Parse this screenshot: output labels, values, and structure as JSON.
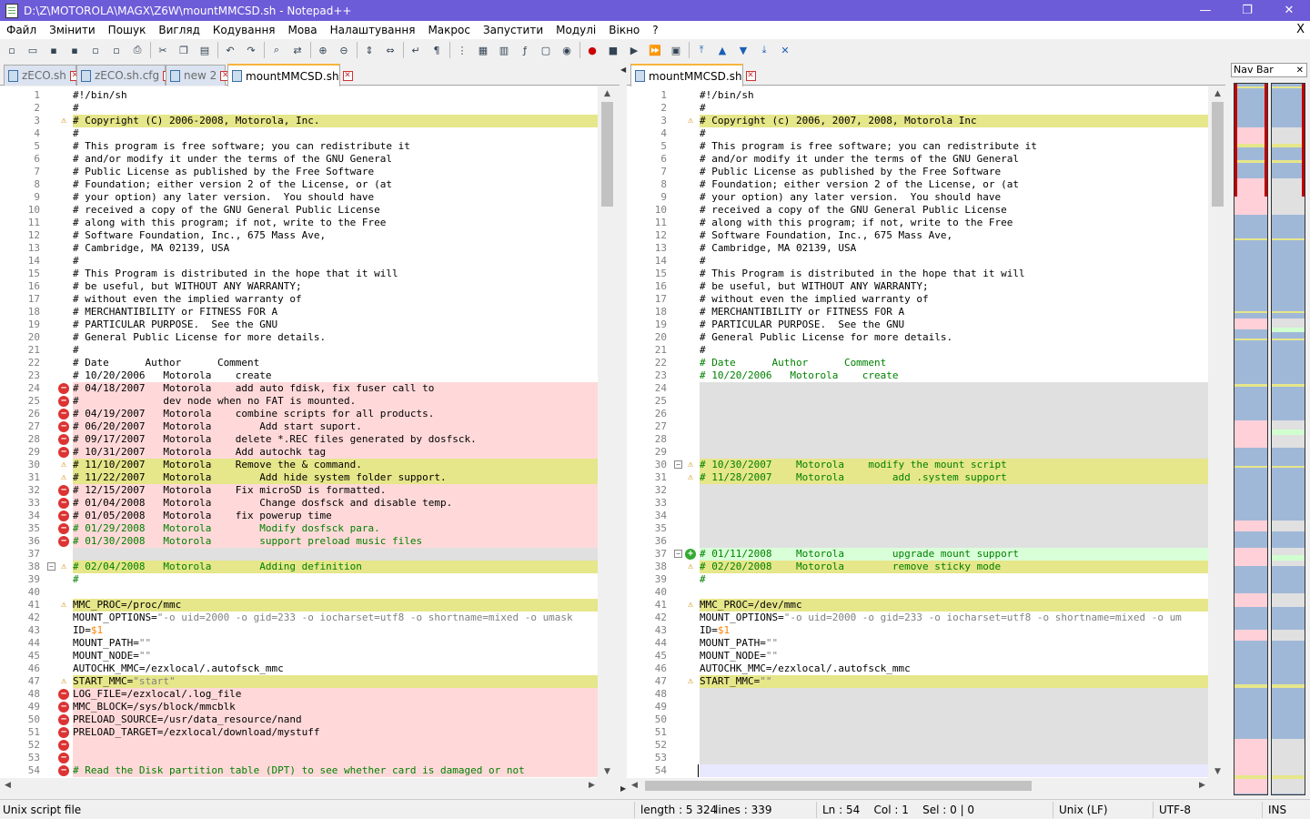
{
  "window": {
    "title": "D:\\Z\\MOTOROLA\\MAGX\\Z6W\\mountMMCSD.sh - Notepad++",
    "minimize": "—",
    "restore": "❐",
    "close": "✕"
  },
  "menu": {
    "items": [
      "Файл",
      "Змінити",
      "Пошук",
      "Вигляд",
      "Кодування",
      "Мова",
      "Налаштування",
      "Макрос",
      "Запустити",
      "Модулі",
      "Вікно",
      "?"
    ],
    "close": "X"
  },
  "toolbar": {
    "icons": [
      "new-icon",
      "open-icon",
      "save-icon",
      "save-all-icon",
      "close-icon",
      "close-all-icon",
      "print-icon",
      "|",
      "cut-icon",
      "copy-icon",
      "paste-icon",
      "|",
      "undo-icon",
      "redo-icon",
      "|",
      "find-icon",
      "replace-icon",
      "|",
      "zoom-in-icon",
      "zoom-out-icon",
      "|",
      "sync-v-icon",
      "sync-h-icon",
      "|",
      "wrap-icon",
      "all-chars-icon",
      "|",
      "indent-guide-icon",
      "udl-icon",
      "doc-map-icon",
      "func-list-icon",
      "folder-icon",
      "monitor-icon",
      "|",
      "record-icon",
      "stop-icon",
      "play-icon",
      "play-multi-icon",
      "save-macro-icon",
      "|",
      "compare-first-icon",
      "compare-prev-icon",
      "compare-next-icon",
      "compare-last-icon",
      "compare-clear-icon"
    ]
  },
  "left": {
    "tabs": [
      {
        "label": "zECO.sh",
        "active": false
      },
      {
        "label": "zECO.sh.cfg",
        "active": false
      },
      {
        "label": "new 2",
        "active": false
      },
      {
        "label": "mountMMCSD.sh",
        "active": true
      }
    ],
    "lines": [
      {
        "n": "1",
        "t": "#!/bin/sh",
        "bg": "",
        "m": "",
        "c": "cm"
      },
      {
        "n": "2",
        "t": "#",
        "bg": "",
        "m": "",
        "c": "cm"
      },
      {
        "n": "3",
        "t": "# Copyright (C) 2006-2008, Motorola, Inc.",
        "bg": "w",
        "m": "warn",
        "c": "cm"
      },
      {
        "n": "4",
        "t": "#",
        "bg": "",
        "m": "",
        "c": "cm"
      },
      {
        "n": "5",
        "t": "# This program is free software; you can redistribute it",
        "bg": "",
        "m": "",
        "c": "cm"
      },
      {
        "n": "6",
        "t": "# and/or modify it under the terms of the GNU General",
        "bg": "",
        "m": "",
        "c": "cm"
      },
      {
        "n": "7",
        "t": "# Public License as published by the Free Software",
        "bg": "",
        "m": "",
        "c": "cm"
      },
      {
        "n": "8",
        "t": "# Foundation; either version 2 of the License, or (at",
        "bg": "",
        "m": "",
        "c": "cm"
      },
      {
        "n": "9",
        "t": "# your option) any later version.  You should have",
        "bg": "",
        "m": "",
        "c": "cm"
      },
      {
        "n": "10",
        "t": "# received a copy of the GNU General Public License",
        "bg": "",
        "m": "",
        "c": "cm"
      },
      {
        "n": "11",
        "t": "# along with this program; if not, write to the Free",
        "bg": "",
        "m": "",
        "c": "cm"
      },
      {
        "n": "12",
        "t": "# Software Foundation, Inc., 675 Mass Ave,",
        "bg": "",
        "m": "",
        "c": "cm"
      },
      {
        "n": "13",
        "t": "# Cambridge, MA 02139, USA",
        "bg": "",
        "m": "",
        "c": "cm"
      },
      {
        "n": "14",
        "t": "#",
        "bg": "",
        "m": "",
        "c": "cm"
      },
      {
        "n": "15",
        "t": "# This Program is distributed in the hope that it will",
        "bg": "",
        "m": "",
        "c": "cm"
      },
      {
        "n": "16",
        "t": "# be useful, but WITHOUT ANY WARRANTY;",
        "bg": "",
        "m": "",
        "c": "cm"
      },
      {
        "n": "17",
        "t": "# without even the implied warranty of",
        "bg": "",
        "m": "",
        "c": "cm"
      },
      {
        "n": "18",
        "t": "# MERCHANTIBILITY or FITNESS FOR A",
        "bg": "",
        "m": "",
        "c": "cm"
      },
      {
        "n": "19",
        "t": "# PARTICULAR PURPOSE.  See the GNU",
        "bg": "",
        "m": "",
        "c": "cm"
      },
      {
        "n": "20",
        "t": "# General Public License for more details.",
        "bg": "",
        "m": "",
        "c": "cm"
      },
      {
        "n": "21",
        "t": "#",
        "bg": "",
        "m": "",
        "c": "cm"
      },
      {
        "n": "22",
        "t": "# Date      Author      Comment",
        "bg": "",
        "m": "",
        "c": "cm"
      },
      {
        "n": "23",
        "t": "# 10/20/2006   Motorola    create",
        "bg": "",
        "m": "",
        "c": "cm"
      },
      {
        "n": "24",
        "t": "# 04/18/2007   Motorola    add auto fdisk, fix fuser call to",
        "bg": "d",
        "m": "del",
        "c": "cm"
      },
      {
        "n": "25",
        "t": "#              dev node when no FAT is mounted.",
        "bg": "d",
        "m": "del",
        "c": "cm"
      },
      {
        "n": "26",
        "t": "# 04/19/2007   Motorola    combine scripts for all products.",
        "bg": "d",
        "m": "del",
        "c": "cm"
      },
      {
        "n": "27",
        "t": "# 06/20/2007   Motorola        Add start suport.",
        "bg": "d",
        "m": "del",
        "c": "cm"
      },
      {
        "n": "28",
        "t": "# 09/17/2007   Motorola    delete *.REC files generated by dosfsck.",
        "bg": "d",
        "m": "del",
        "c": "cm"
      },
      {
        "n": "29",
        "t": "# 10/31/2007   Motorola    Add autochk tag",
        "bg": "d",
        "m": "del",
        "c": "cm"
      },
      {
        "n": "30",
        "t": "# 11/10/2007   Motorola    Remove the & command.",
        "bg": "w",
        "m": "warn",
        "c": "cm"
      },
      {
        "n": "31",
        "t": "# 11/22/2007   Motorola        Add hide system folder support.",
        "bg": "w",
        "m": "warn",
        "c": "cm"
      },
      {
        "n": "32",
        "t": "# 12/15/2007   Motorola    Fix microSD is formatted.",
        "bg": "d",
        "m": "del",
        "c": "cm"
      },
      {
        "n": "33",
        "t": "# 01/04/2008   Motorola        Change dosfsck and disable temp.",
        "bg": "d",
        "m": "del",
        "c": "cm"
      },
      {
        "n": "34",
        "t": "# 01/05/2008   Motorola    fix powerup time",
        "bg": "d",
        "m": "del",
        "c": "cm"
      },
      {
        "n": "35",
        "t": "# 01/29/2008   Motorola        Modify dosfsck para.",
        "bg": "d",
        "m": "del",
        "c": "gr"
      },
      {
        "n": "36",
        "t": "# 01/30/2008   Motorola        support preload music files",
        "bg": "d",
        "m": "del",
        "c": "gr"
      },
      {
        "n": "37",
        "t": "",
        "bg": "e",
        "m": "",
        "c": "cm"
      },
      {
        "n": "38",
        "t": "# 02/04/2008   Motorola        Adding definition",
        "bg": "w",
        "m": "warn",
        "c": "gr",
        "fold": "−"
      },
      {
        "n": "39",
        "t": "#",
        "bg": "",
        "m": "",
        "c": "gr"
      },
      {
        "n": "40",
        "t": "",
        "bg": "",
        "m": "",
        "c": "cm"
      },
      {
        "n": "41",
        "t": "MMC_PROC=/proc/mmc",
        "bg": "w",
        "m": "warn",
        "c": "cm"
      },
      {
        "n": "42",
        "t": "MOUNT_OPTIONS=\"-o uid=2000 -o gid=233 -o iocharset=utf8 -o shortname=mixed -o umask",
        "bg": "",
        "m": "",
        "c": "cm"
      },
      {
        "n": "43",
        "t": "ID=$1",
        "bg": "",
        "m": "",
        "c": "cm"
      },
      {
        "n": "44",
        "t": "MOUNT_PATH=\"\"",
        "bg": "",
        "m": "",
        "c": "cm"
      },
      {
        "n": "45",
        "t": "MOUNT_NODE=\"\"",
        "bg": "",
        "m": "",
        "c": "cm"
      },
      {
        "n": "46",
        "t": "AUTOCHK_MMC=/ezxlocal/.autofsck_mmc",
        "bg": "",
        "m": "",
        "c": "cm"
      },
      {
        "n": "47",
        "t": "START_MMC=\"start\"",
        "bg": "w",
        "m": "warn",
        "c": "cm"
      },
      {
        "n": "48",
        "t": "LOG_FILE=/ezxlocal/.log_file",
        "bg": "d",
        "m": "del",
        "c": "cm"
      },
      {
        "n": "49",
        "t": "MMC_BLOCK=/sys/block/mmcblk",
        "bg": "d",
        "m": "del",
        "c": "cm"
      },
      {
        "n": "50",
        "t": "PRELOAD_SOURCE=/usr/data_resource/nand",
        "bg": "d",
        "m": "del",
        "c": "cm"
      },
      {
        "n": "51",
        "t": "PRELOAD_TARGET=/ezxlocal/download/mystuff",
        "bg": "d",
        "m": "del",
        "c": "cm"
      },
      {
        "n": "52",
        "t": "",
        "bg": "d",
        "m": "del",
        "c": "cm"
      },
      {
        "n": "53",
        "t": "",
        "bg": "d",
        "m": "del",
        "c": "cm"
      },
      {
        "n": "54",
        "t": "# Read the Disk partition table (DPT) to see whether card is damaged or not",
        "bg": "d",
        "m": "del",
        "c": "gr"
      }
    ]
  },
  "right": {
    "tabs": [
      {
        "label": "mountMMCSD.sh",
        "active": true
      }
    ],
    "lines": [
      {
        "n": "1",
        "t": "#!/bin/sh",
        "bg": "",
        "m": "",
        "c": "cm"
      },
      {
        "n": "2",
        "t": "#",
        "bg": "",
        "m": "",
        "c": "cm"
      },
      {
        "n": "3",
        "t": "# Copyright (c) 2006, 2007, 2008, Motorola Inc",
        "bg": "w",
        "m": "warn",
        "c": "cm"
      },
      {
        "n": "4",
        "t": "#",
        "bg": "",
        "m": "",
        "c": "cm"
      },
      {
        "n": "5",
        "t": "# This program is free software; you can redistribute it",
        "bg": "",
        "m": "",
        "c": "cm"
      },
      {
        "n": "6",
        "t": "# and/or modify it under the terms of the GNU General",
        "bg": "",
        "m": "",
        "c": "cm"
      },
      {
        "n": "7",
        "t": "# Public License as published by the Free Software",
        "bg": "",
        "m": "",
        "c": "cm"
      },
      {
        "n": "8",
        "t": "# Foundation; either version 2 of the License, or (at",
        "bg": "",
        "m": "",
        "c": "cm"
      },
      {
        "n": "9",
        "t": "# your option) any later version.  You should have",
        "bg": "",
        "m": "",
        "c": "cm"
      },
      {
        "n": "10",
        "t": "# received a copy of the GNU General Public License",
        "bg": "",
        "m": "",
        "c": "cm"
      },
      {
        "n": "11",
        "t": "# along with this program; if not, write to the Free",
        "bg": "",
        "m": "",
        "c": "cm"
      },
      {
        "n": "12",
        "t": "# Software Foundation, Inc., 675 Mass Ave,",
        "bg": "",
        "m": "",
        "c": "cm"
      },
      {
        "n": "13",
        "t": "# Cambridge, MA 02139, USA",
        "bg": "",
        "m": "",
        "c": "cm"
      },
      {
        "n": "14",
        "t": "#",
        "bg": "",
        "m": "",
        "c": "cm"
      },
      {
        "n": "15",
        "t": "# This Program is distributed in the hope that it will",
        "bg": "",
        "m": "",
        "c": "cm"
      },
      {
        "n": "16",
        "t": "# be useful, but WITHOUT ANY WARRANTY;",
        "bg": "",
        "m": "",
        "c": "cm"
      },
      {
        "n": "17",
        "t": "# without even the implied warranty of",
        "bg": "",
        "m": "",
        "c": "cm"
      },
      {
        "n": "18",
        "t": "# MERCHANTIBILITY or FITNESS FOR A",
        "bg": "",
        "m": "",
        "c": "cm"
      },
      {
        "n": "19",
        "t": "# PARTICULAR PURPOSE.  See the GNU",
        "bg": "",
        "m": "",
        "c": "cm"
      },
      {
        "n": "20",
        "t": "# General Public License for more details.",
        "bg": "",
        "m": "",
        "c": "cm"
      },
      {
        "n": "21",
        "t": "#",
        "bg": "",
        "m": "",
        "c": "cm"
      },
      {
        "n": "22",
        "t": "# Date      Author      Comment",
        "bg": "",
        "m": "",
        "c": "gr"
      },
      {
        "n": "23",
        "t": "# 10/20/2006   Motorola    create",
        "bg": "",
        "m": "",
        "c": "gr"
      },
      {
        "n": "24",
        "t": "",
        "bg": "e",
        "m": "",
        "c": "cm"
      },
      {
        "n": "25",
        "t": "",
        "bg": "e",
        "m": "",
        "c": "cm"
      },
      {
        "n": "26",
        "t": "",
        "bg": "e",
        "m": "",
        "c": "cm"
      },
      {
        "n": "27",
        "t": "",
        "bg": "e",
        "m": "",
        "c": "cm"
      },
      {
        "n": "28",
        "t": "",
        "bg": "e",
        "m": "",
        "c": "cm"
      },
      {
        "n": "29",
        "t": "",
        "bg": "e",
        "m": "",
        "c": "cm"
      },
      {
        "n": "30",
        "t": "# 10/30/2007    Motorola    modify the mount script",
        "bg": "w",
        "m": "warn",
        "c": "gr",
        "fold": "−"
      },
      {
        "n": "31",
        "t": "# 11/28/2007    Motorola        add .system support",
        "bg": "w",
        "m": "warn",
        "c": "gr"
      },
      {
        "n": "32",
        "t": "",
        "bg": "e",
        "m": "",
        "c": "cm"
      },
      {
        "n": "33",
        "t": "",
        "bg": "e",
        "m": "",
        "c": "cm"
      },
      {
        "n": "34",
        "t": "",
        "bg": "e",
        "m": "",
        "c": "cm"
      },
      {
        "n": "35",
        "t": "",
        "bg": "e",
        "m": "",
        "c": "cm"
      },
      {
        "n": "36",
        "t": "",
        "bg": "e",
        "m": "",
        "c": "cm"
      },
      {
        "n": "37",
        "t": "# 01/11/2008    Motorola        upgrade mount support",
        "bg": "a",
        "m": "add",
        "c": "gr",
        "fold": "−"
      },
      {
        "n": "38",
        "t": "# 02/20/2008    Motorola        remove sticky mode",
        "bg": "w",
        "m": "warn",
        "c": "gr"
      },
      {
        "n": "39",
        "t": "#",
        "bg": "",
        "m": "",
        "c": "gr"
      },
      {
        "n": "40",
        "t": "",
        "bg": "",
        "m": "",
        "c": "cm"
      },
      {
        "n": "41",
        "t": "MMC_PROC=/dev/mmc",
        "bg": "w",
        "m": "warn",
        "c": "cm"
      },
      {
        "n": "42",
        "t": "MOUNT_OPTIONS=\"-o uid=2000 -o gid=233 -o iocharset=utf8 -o shortname=mixed -o um",
        "bg": "",
        "m": "",
        "c": "cm"
      },
      {
        "n": "43",
        "t": "ID=$1",
        "bg": "",
        "m": "",
        "c": "cm"
      },
      {
        "n": "44",
        "t": "MOUNT_PATH=\"\"",
        "bg": "",
        "m": "",
        "c": "cm"
      },
      {
        "n": "45",
        "t": "MOUNT_NODE=\"\"",
        "bg": "",
        "m": "",
        "c": "cm"
      },
      {
        "n": "46",
        "t": "AUTOCHK_MMC=/ezxlocal/.autofsck_mmc",
        "bg": "",
        "m": "",
        "c": "cm"
      },
      {
        "n": "47",
        "t": "START_MMC=\"\"",
        "bg": "w",
        "m": "warn",
        "c": "cm"
      },
      {
        "n": "48",
        "t": "",
        "bg": "e",
        "m": "",
        "c": "cm"
      },
      {
        "n": "49",
        "t": "",
        "bg": "e",
        "m": "",
        "c": "cm"
      },
      {
        "n": "50",
        "t": "",
        "bg": "e",
        "m": "",
        "c": "cm"
      },
      {
        "n": "51",
        "t": "",
        "bg": "e",
        "m": "",
        "c": "cm"
      },
      {
        "n": "52",
        "t": "",
        "bg": "e",
        "m": "",
        "c": "cm"
      },
      {
        "n": "53",
        "t": "",
        "bg": "e",
        "m": "",
        "c": "cm"
      },
      {
        "n": "54",
        "t": "",
        "bg": "c",
        "m": "",
        "c": "cm"
      }
    ]
  },
  "navbar": {
    "title": "Nav Bar",
    "close": "✕",
    "colors": {
      "same": "#a0b8d8",
      "warn": "#e6e68a",
      "del": "#ffd0d8",
      "add": "#d0ffd0",
      "empty": "#e0e0e0",
      "cur": "#c00000"
    }
  },
  "status": {
    "file_type": "Unix script file",
    "length": "length : 5 324",
    "lines": "lines : 339",
    "position": "Ln : 54    Col : 1    Sel : 0 | 0",
    "eol": "Unix (LF)",
    "encoding": "UTF-8",
    "mode": "INS"
  },
  "colors": {
    "titlebar": "#6c5cd8",
    "changed": "#e6e68a",
    "removed": "#ffd9d9",
    "added": "#d9ffd9",
    "blank": "#e0e0e0",
    "comment_green": "#008000",
    "variable_orange": "#ff8000"
  }
}
